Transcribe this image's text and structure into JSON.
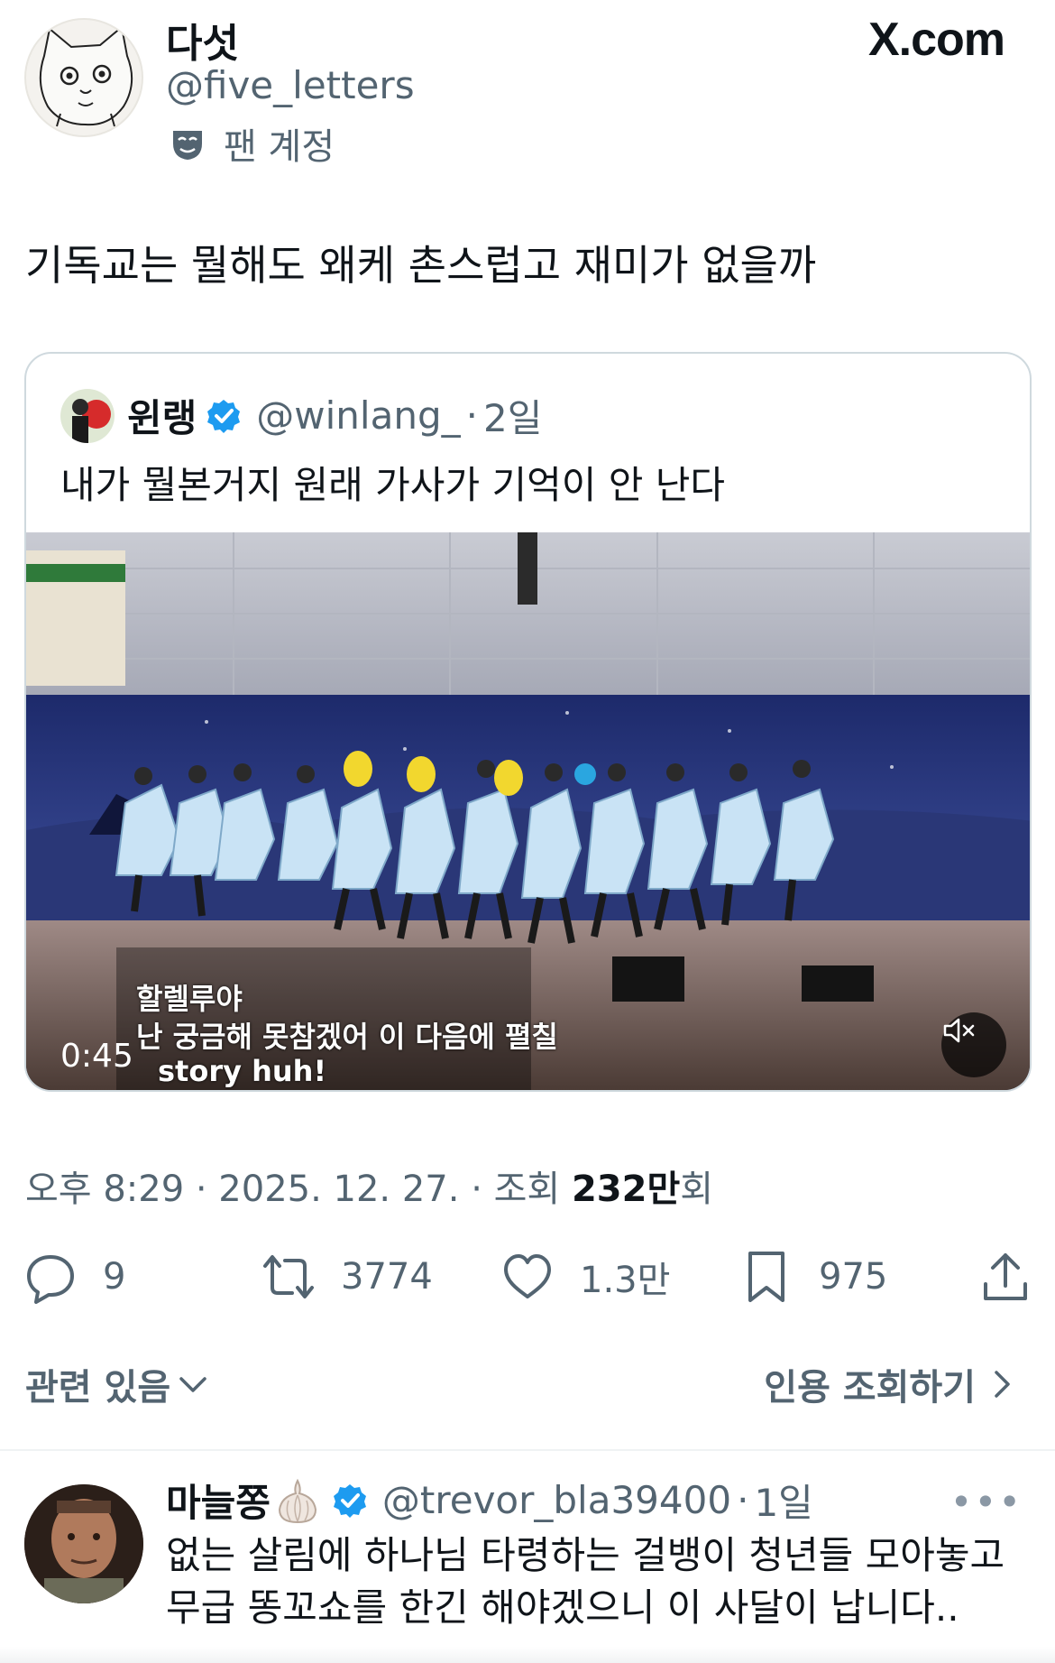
{
  "author": {
    "name": "다섯",
    "handle": "@five_letters",
    "badge_label": "팬 계정",
    "badge_icon": "mask-icon"
  },
  "brand": "X.com",
  "tweet": {
    "text": "기독교는 뭘해도 왜케 촌스럽고 재미가 없을까"
  },
  "quoted": {
    "name": "윈랭",
    "handle": "@winlang_",
    "separator": "·",
    "time": "2일",
    "text": "내가 뭘본거지 원래 가사가 기억이 안 난다",
    "video": {
      "duration": "0:45",
      "caption_line1": "할렐루야",
      "caption_line2": "난 궁금해 못참겠어 이 다음에 펼칠",
      "caption_line3": "story huh!"
    }
  },
  "meta": {
    "time": "오후 8:29",
    "date": "2025. 12. 27.",
    "views_label": "조회",
    "views_value": "232만",
    "views_suffix": "회",
    "dot": "·"
  },
  "actions": {
    "replies": "9",
    "reposts": "3774",
    "likes": "1.3만",
    "bookmarks": "975"
  },
  "related": {
    "label": "관련 있음",
    "quote_views": "인용 조회하기"
  },
  "reply": {
    "name": "마늘쫑",
    "emoji": "garlic-icon",
    "handle": "@trevor_bla39400",
    "separator": "·",
    "time": "1일",
    "more": "•••",
    "line1": "없는 살림에 하나님 타령하는 걸뱅이 청년들 모아놓고",
    "line2": "무급 똥꼬쇼를 한긴 해야겠으니 이 사달이 납니다.."
  },
  "colors": {
    "text": "#0f1419",
    "secondary": "#536471",
    "border": "#cfd9de",
    "verified": "#1d9bf0"
  }
}
